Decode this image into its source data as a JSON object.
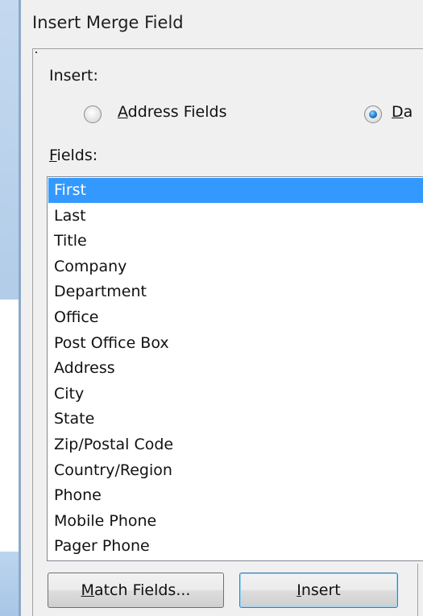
{
  "dialog": {
    "title": "Insert Merge Field",
    "insert_label": "Insert:",
    "radio_address_label": "Address Fields",
    "radio_database_label": "Da",
    "fields_label": "Fields:",
    "fields": [
      "First",
      "Last",
      "Title",
      "Company",
      "Department",
      "Office",
      "Post Office Box",
      "Address",
      "City",
      "State",
      "Zip/Postal Code",
      "Country/Region",
      "Phone",
      "Mobile Phone",
      "Pager Phone"
    ],
    "selected_field": "First",
    "match_fields_button": "Match Fields...",
    "insert_button": "Insert"
  },
  "colors": {
    "selection": "#3399ff",
    "frame": "#b3cde9"
  }
}
